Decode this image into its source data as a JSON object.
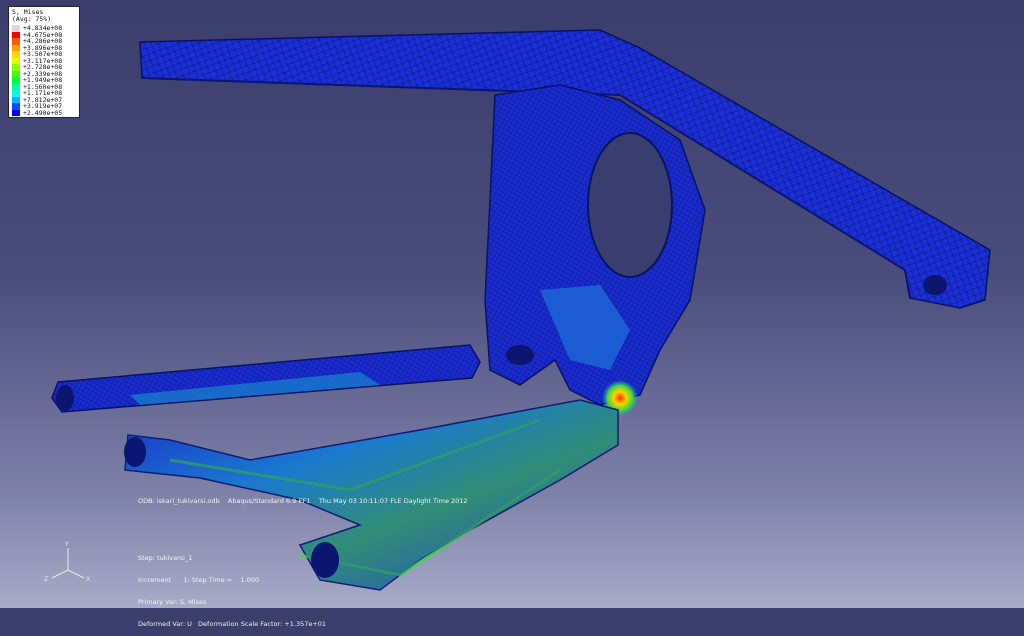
{
  "legend": {
    "title": "S, Mises",
    "subtitle": "(Avg: 75%)",
    "entries": [
      {
        "label": "+4.834e+08",
        "color": "#d9d9d9"
      },
      {
        "label": "+4.675e+08",
        "color": "#ff0000"
      },
      {
        "label": "+4.286e+08",
        "color": "#ff5a00"
      },
      {
        "label": "+3.896e+08",
        "color": "#ff9f00"
      },
      {
        "label": "+3.507e+08",
        "color": "#ffd900"
      },
      {
        "label": "+3.117e+08",
        "color": "#d9ff00"
      },
      {
        "label": "+2.728e+08",
        "color": "#8fff00"
      },
      {
        "label": "+2.339e+08",
        "color": "#3cff00"
      },
      {
        "label": "+1.949e+08",
        "color": "#00ff3c"
      },
      {
        "label": "+1.560e+08",
        "color": "#00ff9f"
      },
      {
        "label": "+1.171e+08",
        "color": "#00ffe6"
      },
      {
        "label": "+7.812e+07",
        "color": "#00b4ff"
      },
      {
        "label": "+3.919e+07",
        "color": "#0050ff"
      },
      {
        "label": "+2.490e+05",
        "color": "#0000ff"
      }
    ]
  },
  "odb_line": "ODB: iskari_tukivarsi.odb    Abaqus/Standard 6.9-EF1    Thu May 03 10:11:07 FLE Daylight Time 2012",
  "step": {
    "step": "Step: tukivarsi_1",
    "increment": "Increment      1: Step Time =    1.000",
    "primary_var": "Primary Var: S, Mises",
    "deformed_var": "Deformed Var: U   Deformation Scale Factor: +1.357e+01"
  },
  "triad": {
    "y": "Y",
    "z": "Z",
    "x": "X"
  },
  "colors": {
    "mesh_blue": "#1a2fd6",
    "mesh_dark": "#0c1a8f",
    "stress_cyan": "#18b4d8",
    "stress_green": "#3cd83c",
    "hotspot": "#ff3a00"
  }
}
